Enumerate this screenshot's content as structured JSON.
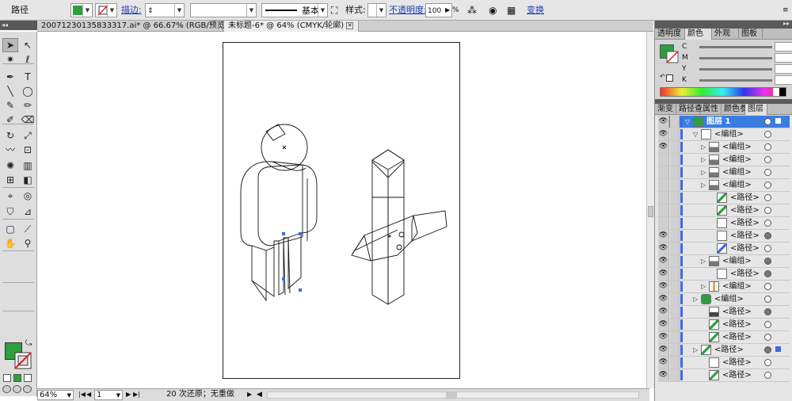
{
  "control_bar": {
    "selection_type": "路径",
    "fill_color": "#2e9e3e",
    "stroke_label": "描边:",
    "stroke_weight": "",
    "stroke_profile_value": "",
    "brush_label": "基本",
    "style_label": "样式:",
    "opacity_label": "不透明度:",
    "opacity_value": "100",
    "percent": "%",
    "transform_label": "变换"
  },
  "document_tabs": [
    {
      "label": "20071230135833317.ai* @ 66.67% (RGB/预览)",
      "active": false
    },
    {
      "label": "未标题-6* @ 64% (CMYK/轮廓)",
      "active": true
    }
  ],
  "tools": {
    "icons": [
      "selection-arrow",
      "direct-selection",
      "magic-wand",
      "lasso",
      "pen",
      "type",
      "line",
      "ellipse",
      "paintbrush",
      "pencil",
      "blob-brush",
      "eraser",
      "rotate",
      "scale",
      "warp",
      "free-transform",
      "symbol-sprayer",
      "column-graph",
      "mesh",
      "gradient",
      "eyedropper",
      "blend",
      "live-paint-bucket",
      "live-paint-selection",
      "artboard",
      "slice",
      "hand",
      "zoom"
    ],
    "fill_swatch": "#2e9e3e"
  },
  "status_bar": {
    "zoom": "64%",
    "artboard_number": "1",
    "status_text": "20 次还原；无重做"
  },
  "color_panel": {
    "tabs": [
      {
        "label": "透明度",
        "active": false
      },
      {
        "label": "颜色",
        "active": true
      },
      {
        "label": "外观",
        "active": false
      },
      {
        "label": "图板",
        "active": false
      }
    ],
    "channels": [
      {
        "label": "C",
        "value": ""
      },
      {
        "label": "M",
        "value": ""
      },
      {
        "label": "Y",
        "value": ""
      },
      {
        "label": "K",
        "value": ""
      }
    ],
    "fill_color": "#2e9e3e"
  },
  "layers_panel": {
    "tabs": [
      {
        "label": "渐变",
        "active": false
      },
      {
        "label": "路径查",
        "active": false
      },
      {
        "label": "属性",
        "active": false
      },
      {
        "label": "颜色参",
        "active": false
      },
      {
        "label": "图层",
        "active": true
      }
    ],
    "rows": [
      {
        "name": "图层 1",
        "level": 0,
        "eye": true,
        "twisty": "open",
        "thumb": "layer",
        "target": "open",
        "selected": true,
        "highlight": true
      },
      {
        "name": "<编组>",
        "level": 1,
        "eye": true,
        "twisty": "open",
        "thumb": "figure",
        "target": "open"
      },
      {
        "name": "<编组>",
        "level": 2,
        "eye": true,
        "twisty": "closed",
        "thumb": "group",
        "target": "open"
      },
      {
        "name": "<编组>",
        "level": 2,
        "eye": false,
        "twisty": "closed",
        "thumb": "group",
        "target": "open"
      },
      {
        "name": "<编组>",
        "level": 2,
        "eye": false,
        "twisty": "closed",
        "thumb": "group",
        "target": "open"
      },
      {
        "name": "<编组>",
        "level": 2,
        "eye": false,
        "twisty": "closed",
        "thumb": "group",
        "target": "open"
      },
      {
        "name": "<路径>",
        "level": 3,
        "eye": false,
        "twisty": "none",
        "thumb": "path-green",
        "target": "open"
      },
      {
        "name": "<路径>",
        "level": 3,
        "eye": false,
        "twisty": "none",
        "thumb": "path-green",
        "target": "open"
      },
      {
        "name": "<路径>",
        "level": 3,
        "eye": false,
        "twisty": "none",
        "thumb": "path",
        "target": "open"
      },
      {
        "name": "<路径>",
        "level": 3,
        "eye": true,
        "twisty": "none",
        "thumb": "path",
        "target": "filled"
      },
      {
        "name": "<路径>",
        "level": 3,
        "eye": true,
        "twisty": "none",
        "thumb": "path-blue",
        "target": "open"
      },
      {
        "name": "<编组>",
        "level": 2,
        "eye": true,
        "twisty": "closed",
        "thumb": "group",
        "target": "filled"
      },
      {
        "name": "<路径>",
        "level": 3,
        "eye": true,
        "twisty": "none",
        "thumb": "path",
        "target": "filled"
      },
      {
        "name": "<编组>",
        "level": 2,
        "eye": true,
        "twisty": "closed",
        "thumb": "group-orange",
        "target": "open"
      },
      {
        "name": "<编组>",
        "level": 1,
        "eye": true,
        "twisty": "closed",
        "thumb": "group-green",
        "target": "open"
      },
      {
        "name": "<路径>",
        "level": 2,
        "eye": true,
        "twisty": "none",
        "thumb": "path-dark",
        "target": "filled"
      },
      {
        "name": "<路径>",
        "level": 2,
        "eye": true,
        "twisty": "none",
        "thumb": "path-green",
        "target": "open"
      },
      {
        "name": "<路径>",
        "level": 2,
        "eye": true,
        "twisty": "none",
        "thumb": "path-green",
        "target": "open"
      },
      {
        "name": "<路径>",
        "level": 1,
        "eye": true,
        "twisty": "closed",
        "thumb": "path-green",
        "target": "selected"
      },
      {
        "name": "<路径>",
        "level": 2,
        "eye": true,
        "twisty": "none",
        "thumb": "path",
        "target": "open"
      },
      {
        "name": "<路径>",
        "level": 2,
        "eye": true,
        "twisty": "none",
        "thumb": "path-green",
        "target": "open"
      }
    ]
  },
  "colors": {
    "layer_color": "#3f67e6",
    "selected_row": "#3a7de0"
  }
}
